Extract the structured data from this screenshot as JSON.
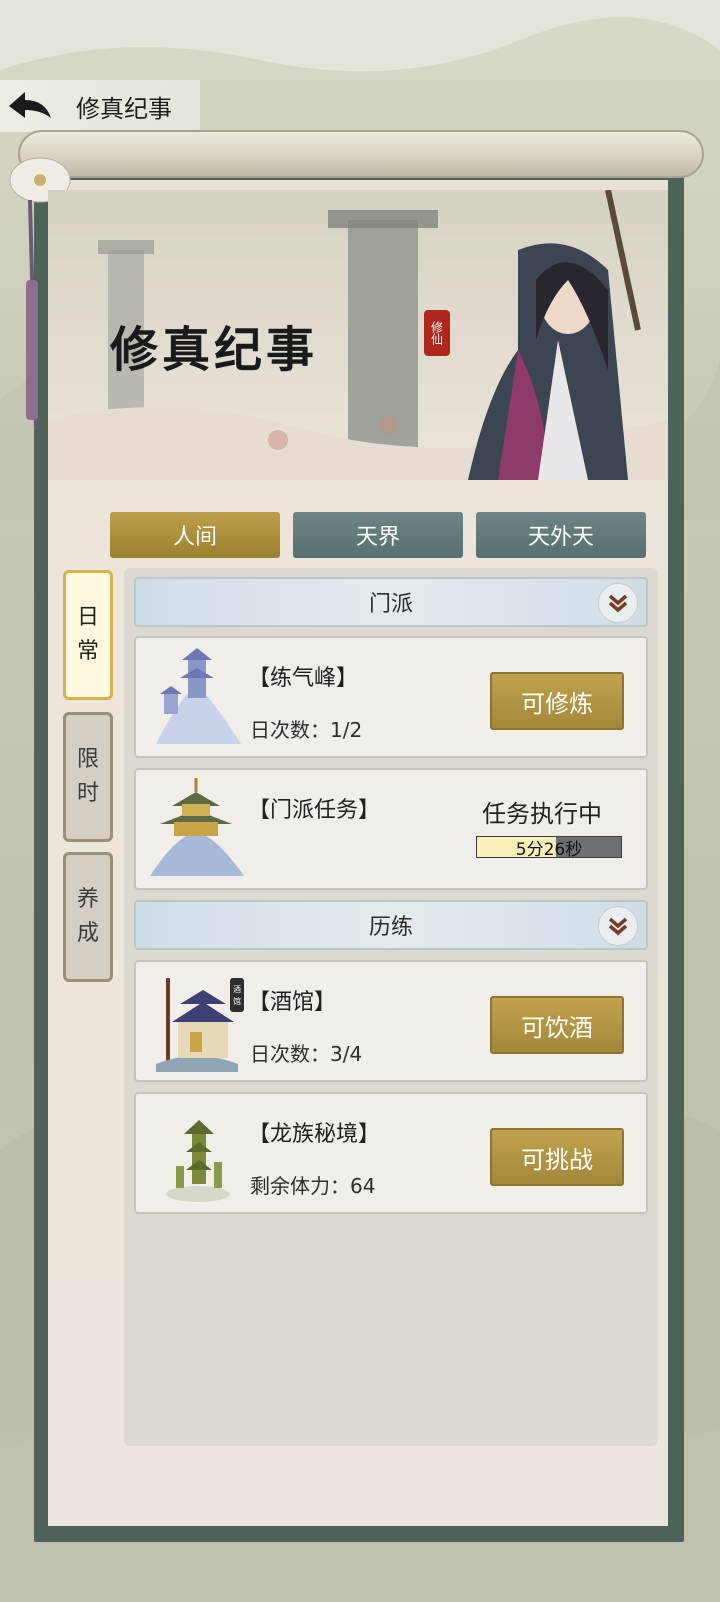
{
  "header": {
    "title": "修真纪事"
  },
  "banner": {
    "title": "修真纪事",
    "seal": "修仙"
  },
  "realm_tabs": [
    {
      "label": "人间",
      "active": true
    },
    {
      "label": "天界",
      "active": false
    },
    {
      "label": "天外天",
      "active": false
    }
  ],
  "side_tabs": [
    {
      "label": "日常",
      "chars": [
        "日",
        "常"
      ],
      "active": true
    },
    {
      "label": "限时",
      "chars": [
        "限",
        "时"
      ],
      "active": false
    },
    {
      "label": "养成",
      "chars": [
        "养",
        "成"
      ],
      "active": false
    }
  ],
  "sections": [
    {
      "title": "门派",
      "cards": [
        {
          "name": "【练气峰】",
          "sub": "日次数：1/2",
          "button": "可修炼"
        },
        {
          "name": "【门派任务】",
          "status": "任务执行中",
          "timer": "5分26秒",
          "progress": 0.55
        }
      ]
    },
    {
      "title": "历练",
      "cards": [
        {
          "name": "【酒馆】",
          "sub": "日次数：3/4",
          "button": "可饮酒",
          "sign": "酒馆"
        },
        {
          "name": "【龙族秘境】",
          "sub": "剩余体力：64",
          "button": "可挑战"
        }
      ]
    }
  ],
  "colors": {
    "gold": "#b39643",
    "teal": "#607878",
    "frame": "#4d6358"
  }
}
